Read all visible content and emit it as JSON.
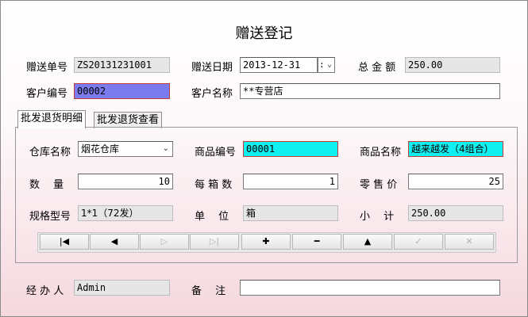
{
  "form": {
    "title": "赠送登记"
  },
  "header": {
    "gift_no_label": "赠送单号",
    "gift_no_value": "ZS20131231001",
    "gift_date_label": "赠送日期",
    "gift_date_value": "2013-12-31",
    "total_label": "总 金 额",
    "total_value": "250.00",
    "customer_no_label": "客户编号",
    "customer_no_value": "00002",
    "customer_name_label": "客户名称",
    "customer_name_value": "**专营店"
  },
  "tabs": [
    {
      "label": "批发退货明细",
      "active": true
    },
    {
      "label": "批发退货查看",
      "active": false
    }
  ],
  "detail": {
    "warehouse_label": "仓库名称",
    "warehouse_value": "烟花仓库",
    "product_no_label": "商品编号",
    "product_no_value": "00001",
    "product_name_label": "商品名称",
    "product_name_value": "越来越发（4组合）",
    "quantity_label": "数　 量",
    "quantity_value": "10",
    "per_box_label": "每 箱 数",
    "per_box_value": "1",
    "retail_label": "零 售 价",
    "retail_value": "25",
    "spec_label": "规格型号",
    "spec_value": "1*1（72发）",
    "unit_label": "单　 位",
    "unit_value": "箱",
    "subtotal_label": "小　 计",
    "subtotal_value": "250.00"
  },
  "nav_buttons": [
    {
      "name": "first-record",
      "glyph": "|◀",
      "enabled": true
    },
    {
      "name": "prev-record",
      "glyph": "◀",
      "enabled": true
    },
    {
      "name": "next-record",
      "glyph": "▷",
      "enabled": false
    },
    {
      "name": "last-record",
      "glyph": "▷|",
      "enabled": false
    },
    {
      "name": "add-record",
      "glyph": "✚",
      "enabled": true
    },
    {
      "name": "delete-record",
      "glyph": "━",
      "enabled": true
    },
    {
      "name": "edit-record",
      "glyph": "▲",
      "enabled": true
    },
    {
      "name": "post-record",
      "glyph": "✓",
      "enabled": false
    },
    {
      "name": "cancel-record",
      "glyph": "✕",
      "enabled": false
    }
  ],
  "footer": {
    "handler_label": "经 办 人",
    "handler_value": "Admin",
    "remark_label": "备　 注",
    "remark_value": ""
  }
}
